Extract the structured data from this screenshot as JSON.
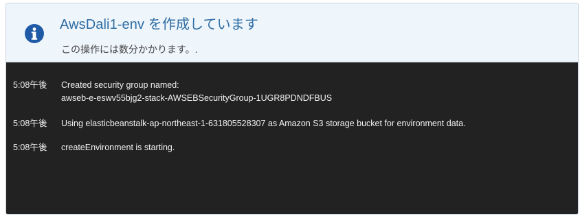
{
  "notification": {
    "icon": "info-icon",
    "title": "AwsDali1-env を作成しています",
    "subtitle": "この操作には数分かかります。."
  },
  "colors": {
    "title": "#2e6da4",
    "icon": "#1f5aa6",
    "header_bg": "#eef5fb",
    "log_bg": "#222222",
    "log_text": "#f2f2f2"
  },
  "events": [
    {
      "time": "5:08午後",
      "message_lines": [
        "Created security group named:",
        "awseb-e-eswv55bjg2-stack-AWSEBSecurityGroup-1UGR8PDNDFBUS"
      ]
    },
    {
      "time": "5:08午後",
      "message_lines": [
        "Using elasticbeanstalk-ap-northeast-1-631805528307 as Amazon S3 storage bucket for environment data."
      ]
    },
    {
      "time": "5:08午後",
      "message_lines": [
        "createEnvironment is starting."
      ]
    }
  ]
}
